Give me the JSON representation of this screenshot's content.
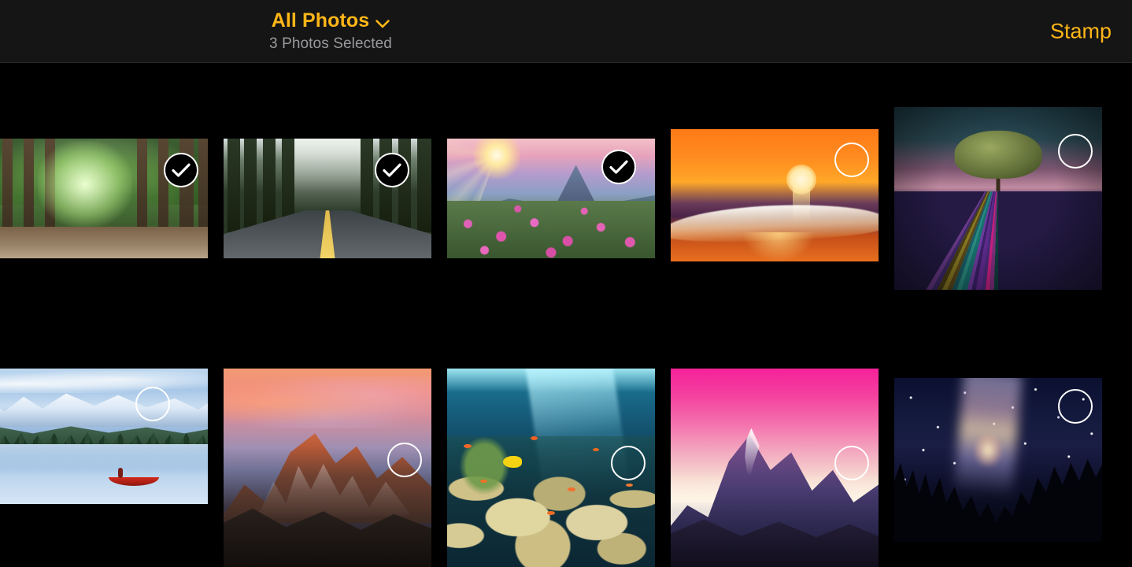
{
  "app": {
    "background_color": "#000000",
    "accent_color": "#FFB617",
    "header_background": "#151515",
    "muted_text_color": "#9a9a9e"
  },
  "header": {
    "title": "All Photos",
    "title_chevron_icon": "chevron-down-icon",
    "subtitle": "3 Photos Selected",
    "action_label": "Stamp"
  },
  "selection": {
    "selected_count": 3,
    "total_visible": 10,
    "checked_icon": "checkmark-icon",
    "unchecked_icon": "empty-circle-icon"
  },
  "grid": {
    "rows": 2,
    "columns": 5,
    "photos": [
      {
        "name": "forest-path",
        "alt": "Sunlit path through tall green forest trees",
        "selected": true
      },
      {
        "name": "redwood-road",
        "alt": "Empty road through misty redwood forest",
        "selected": true
      },
      {
        "name": "flower-meadow",
        "alt": "Pink flower meadow at sunrise with mountain peak",
        "selected": true
      },
      {
        "name": "ocean-sunset",
        "alt": "Orange sunset over breaking ocean wave",
        "selected": false
      },
      {
        "name": "lavender-field",
        "alt": "Lone tree above colorful lavender field at dusk",
        "selected": false
      },
      {
        "name": "mountain-lake",
        "alt": "Red canoe on a calm lake below snowy mountains",
        "selected": false
      },
      {
        "name": "alpine-sunset",
        "alt": "Orange alpenglow on rugged snowy mountain peaks",
        "selected": false
      },
      {
        "name": "coral-reef",
        "alt": "Underwater coral reef with yellow and orange fish",
        "selected": false
      },
      {
        "name": "pink-sky-mountain",
        "alt": "Purple mountain ridge under a vivid pink sky",
        "selected": false
      },
      {
        "name": "milky-way-forest",
        "alt": "Milky Way over silhouetted pine forest",
        "selected": false
      }
    ]
  }
}
